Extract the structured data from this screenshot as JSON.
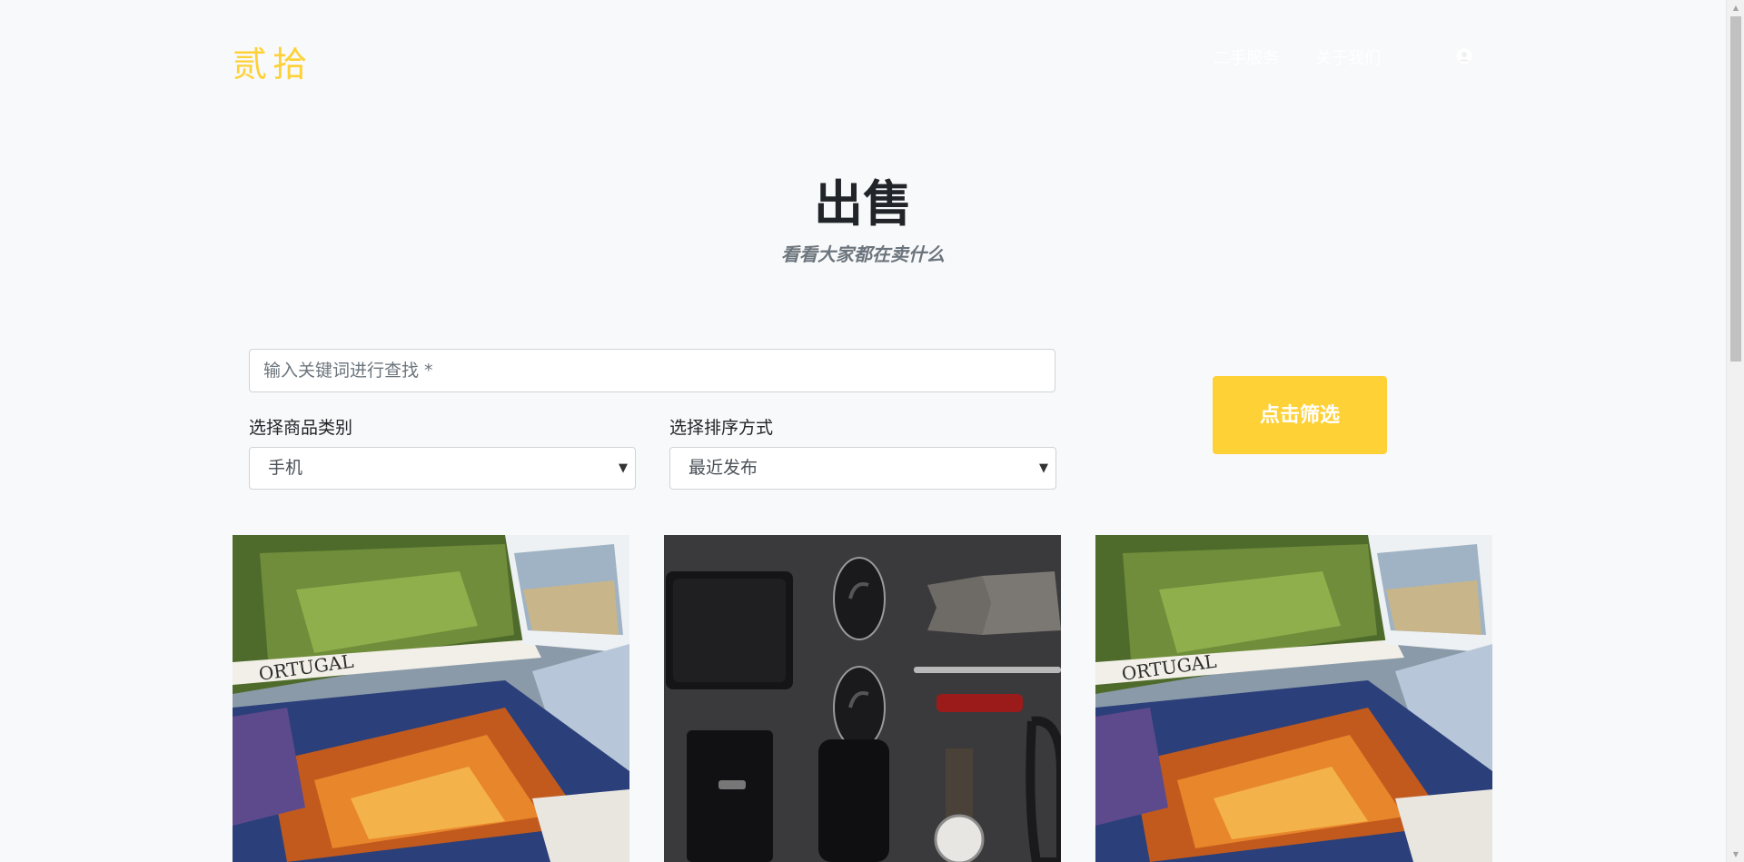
{
  "navbar": {
    "brand": "贰拾",
    "links": [
      {
        "label": "二手服务"
      },
      {
        "label": "关于我们"
      }
    ],
    "user_icon": "user-circle-icon"
  },
  "header": {
    "title": "出售",
    "subtitle": "看看大家都在卖什么"
  },
  "filter": {
    "search_placeholder": "输入关键词进行查找 *",
    "search_value": "",
    "category_label": "选择商品类别",
    "category_selected": "手机",
    "sort_label": "选择排序方式",
    "sort_selected": "最近发布",
    "submit_label": "点击筛选"
  },
  "products": [
    {
      "image": "postcards-photo"
    },
    {
      "image": "flatlay-accessories-photo"
    },
    {
      "image": "postcards-photo"
    }
  ],
  "colors": {
    "accent": "#fed136",
    "background": "#f8f9fa",
    "heading": "#212529",
    "muted": "#6c757d"
  }
}
